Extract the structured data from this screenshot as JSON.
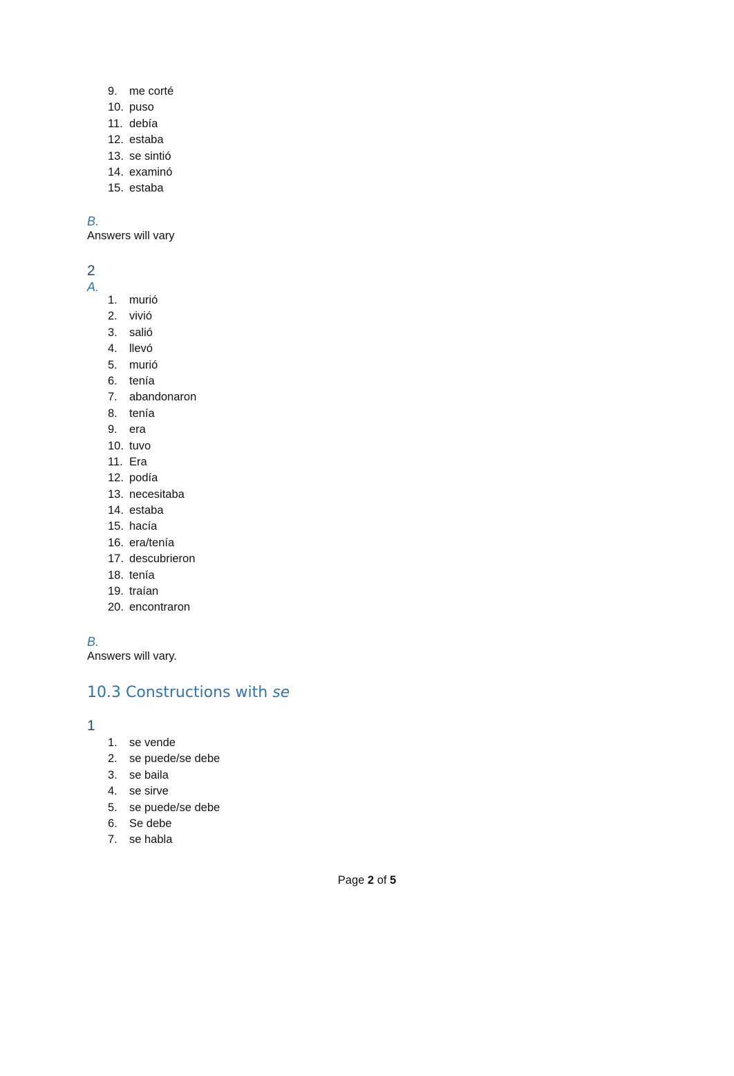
{
  "list_1a_cont": [
    {
      "n": "9.",
      "t": "me corté"
    },
    {
      "n": "10.",
      "t": "puso"
    },
    {
      "n": "11.",
      "t": "debía"
    },
    {
      "n": "12.",
      "t": "estaba"
    },
    {
      "n": "13.",
      "t": "se sintió"
    },
    {
      "n": "14.",
      "t": "examinó"
    },
    {
      "n": "15.",
      "t": "estaba"
    }
  ],
  "part_1b": {
    "label": "B.",
    "text": "Answers will vary"
  },
  "exercise_2": {
    "number": "2",
    "part_a_label": "A."
  },
  "list_2a": [
    {
      "n": "1.",
      "t": "murió"
    },
    {
      "n": "2.",
      "t": "vivió"
    },
    {
      "n": "3.",
      "t": "salió"
    },
    {
      "n": "4.",
      "t": "llevó"
    },
    {
      "n": "5.",
      "t": "murió"
    },
    {
      "n": "6.",
      "t": "tenía"
    },
    {
      "n": "7.",
      "t": "abandonaron"
    },
    {
      "n": "8.",
      "t": "tenía"
    },
    {
      "n": "9.",
      "t": "era"
    },
    {
      "n": "10.",
      "t": "tuvo"
    },
    {
      "n": "11.",
      "t": "Era"
    },
    {
      "n": "12.",
      "t": "podía"
    },
    {
      "n": "13.",
      "t": "necesitaba"
    },
    {
      "n": "14.",
      "t": "estaba"
    },
    {
      "n": "15.",
      "t": "hacía"
    },
    {
      "n": "16.",
      "t": "era/tenía"
    },
    {
      "n": "17.",
      "t": "descubrieron"
    },
    {
      "n": "18.",
      "t": "tenía"
    },
    {
      "n": "19.",
      "t": "traían"
    },
    {
      "n": "20.",
      "t": "encontraron"
    }
  ],
  "part_2b": {
    "label": "B.",
    "text": "Answers will vary."
  },
  "section_10_3": {
    "title_main": "10.3 Constructions with ",
    "title_italic": "se"
  },
  "exercise_10_3_1": {
    "number": "1"
  },
  "list_10_3_1": [
    {
      "n": "1.",
      "t": "se vende"
    },
    {
      "n": "2.",
      "t": "se puede/se debe"
    },
    {
      "n": "3.",
      "t": "se baila"
    },
    {
      "n": "4.",
      "t": "se sirve"
    },
    {
      "n": "5.",
      "t": "se puede/se debe"
    },
    {
      "n": "6.",
      "t": "Se debe"
    },
    {
      "n": "7.",
      "t": "se habla"
    }
  ],
  "footer": {
    "page_word": "Page",
    "current": "2",
    "of_word": "of",
    "total": "5"
  }
}
